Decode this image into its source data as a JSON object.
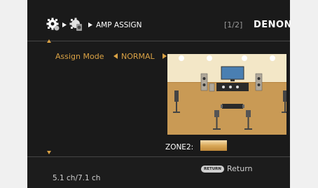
{
  "header": {
    "title": "AMP ASSIGN",
    "page_indicator": "[1/2]",
    "brand": "DENON",
    "icons": [
      "gear-icon",
      "arrow-right-icon",
      "speaker-setup-icon",
      "arrow-right-icon"
    ]
  },
  "assign_mode": {
    "label": "Assign Mode",
    "value": "NORMAL"
  },
  "zone2": {
    "label": "ZONE2:"
  },
  "footer": {
    "return_badge": "RETURN",
    "return_label": "Return",
    "channel_info": "5.1 ch/7.1 ch"
  },
  "colors": {
    "background": "#1a1a1a",
    "accent": "#d9a144",
    "text": "#ffffff",
    "room_wall": "#f3e7c7",
    "room_floor": "#c99a55"
  }
}
